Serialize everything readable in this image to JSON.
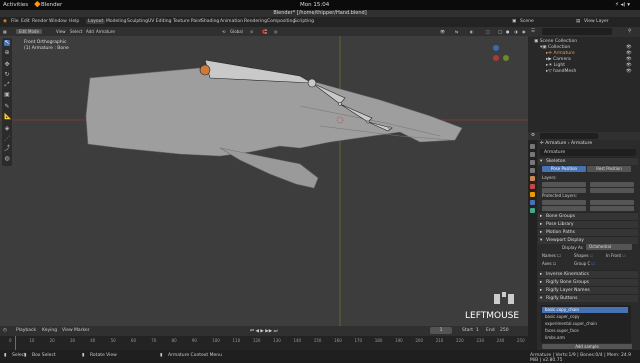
{
  "gnome": {
    "activities": "Activities",
    "app": "Blender",
    "clock": "Mon 15:04"
  },
  "window": {
    "title": "Blender* [/home/thipper/Hand.blend]"
  },
  "menu": {
    "items": [
      "File",
      "Edit",
      "Render",
      "Window",
      "Help"
    ],
    "workspaces": [
      "Layout",
      "Modeling",
      "Sculpting",
      "UV Editing",
      "Texture Paint",
      "Shading",
      "Animation",
      "Rendering",
      "Compositing",
      "Scripting"
    ],
    "active_workspace": "Layout",
    "scene_label": "Scene",
    "view_layer_label": "View Layer"
  },
  "viewport_header": {
    "mode": "Edit Mode",
    "menus": [
      "View",
      "Select",
      "Add",
      "Armature"
    ],
    "orientation": "Global"
  },
  "viewport": {
    "view_name": "Front Orthographic",
    "object_name": "(1) Armature : Bone",
    "last_event": "LEFTMOUSE"
  },
  "outliner": {
    "root": "Scene Collection",
    "items": [
      {
        "label": "Collection",
        "indent": 1
      },
      {
        "label": "Armature",
        "indent": 2
      },
      {
        "label": "Camera",
        "indent": 2
      },
      {
        "label": "Light",
        "indent": 2
      },
      {
        "label": "handMesh",
        "indent": 2
      }
    ]
  },
  "properties": {
    "breadcrumb": [
      "Armature",
      "Armature"
    ],
    "data_name": "Armature",
    "skeleton": {
      "title": "Skeleton",
      "pose_position": "Pose Position",
      "rest_position": "Rest Position",
      "layers_label": "Layers:",
      "protected_label": "Protected Layers:"
    },
    "collapsed_panels": [
      "Bone Groups",
      "Pose Library",
      "Motion Paths"
    ],
    "viewport_display": {
      "title": "Viewport Display",
      "display_as_label": "Display As",
      "display_as_value": "Octahedral",
      "names": "Names",
      "shapes": "Shapes",
      "in_front": "In Front",
      "axes": "Axes",
      "group_colors": "Group C"
    },
    "lower_panels": [
      "Inverse Kinematics",
      "Rigify Bone Groups",
      "Rigify Layer Names",
      "Rigify Buttons"
    ],
    "rig_list": [
      "basic.copy_chain",
      "basic.super_copy",
      "experimental.super_chain",
      "faces.super_face",
      "limbs.arm"
    ],
    "selected_rig": "basic.copy_chain",
    "add_sample": "Add sample"
  },
  "timeline": {
    "menus": [
      "Playback",
      "Keying",
      "View",
      "Marker"
    ],
    "current_frame": "1",
    "start_label": "Start",
    "start": "1",
    "end_label": "End",
    "end": "250",
    "ticks": [
      "0",
      "10",
      "20",
      "30",
      "40",
      "50",
      "60",
      "70",
      "80",
      "90",
      "100",
      "110",
      "120",
      "130",
      "140",
      "150",
      "160",
      "170",
      "180",
      "190",
      "200",
      "210",
      "220",
      "230",
      "240",
      "250"
    ]
  },
  "status": {
    "select": "Select",
    "box_select": "Box Select",
    "rotate": "Rotate View",
    "context_menu": "Armature Context Menu",
    "stats": "Armature | Verts:1/9 | Bones:0/4 | Mem: 24.9 MiB | v2.80.75"
  },
  "colors": {
    "accent": "#4772b3",
    "viewport_bg": "#3d3d3d",
    "mesh": "#9e9e9e",
    "bone": "#c9c9c9",
    "x_axis": "#a83a3a",
    "y_axis": "#6b8a2a"
  }
}
